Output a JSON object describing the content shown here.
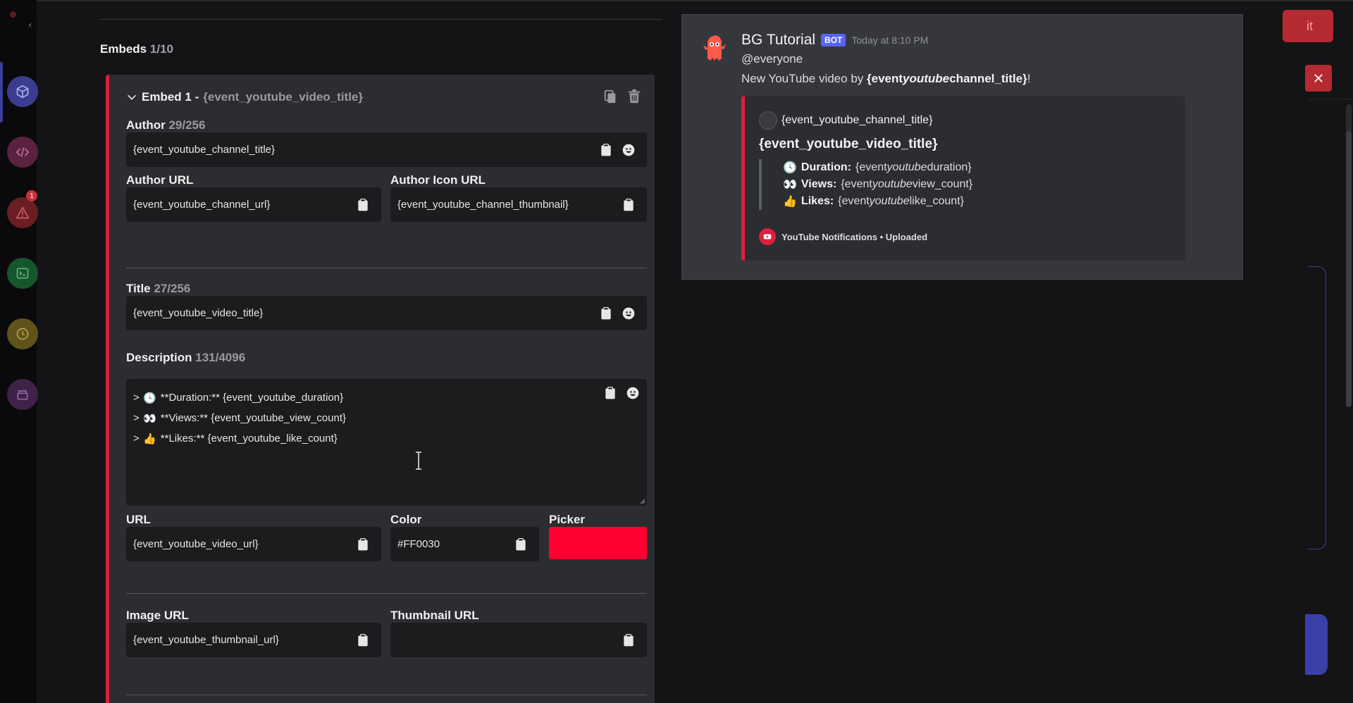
{
  "editor": {
    "embeds_label": "Embeds",
    "embeds_count": "1/10",
    "embed": {
      "title_prefix": "Embed 1 - ",
      "title_value": "{event_youtube_video_title}",
      "author": {
        "label": "Author",
        "count": "29/256",
        "value": "{event_youtube_channel_title}"
      },
      "author_url": {
        "label": "Author URL",
        "value": "{event_youtube_channel_url}"
      },
      "author_icon_url": {
        "label": "Author Icon URL",
        "value": "{event_youtube_channel_thumbnail}"
      },
      "title": {
        "label": "Title",
        "count": "27/256",
        "value": "{event_youtube_video_title}"
      },
      "description": {
        "label": "Description",
        "count": "131/4096",
        "lines": [
          {
            "prefix": ">",
            "emoji": "🕓",
            "text": "**Duration:** {event_youtube_duration}"
          },
          {
            "prefix": ">",
            "emoji": "👀",
            "text": "**Views:** {event_youtube_view_count}"
          },
          {
            "prefix": ">",
            "emoji": "👍",
            "text": "**Likes:** {event_youtube_like_count}"
          }
        ]
      },
      "url": {
        "label": "URL",
        "value": "{event_youtube_video_url}"
      },
      "color": {
        "label": "Color",
        "value": "#FF0030"
      },
      "picker": {
        "label": "Picker",
        "color": "#FF0030"
      },
      "image_url": {
        "label": "Image URL",
        "value": "{event_youtube_thumbnail_url}"
      },
      "thumbnail_url": {
        "label": "Thumbnail URL",
        "value": ""
      }
    }
  },
  "preview": {
    "bot_name": "BG Tutorial",
    "bot_tag": "BOT",
    "timestamp": "Today at 8:10 PM",
    "mention": "@everyone",
    "content_prefix": "New YouTube video by ",
    "content_bold_a": "{event",
    "content_italic": "youtube",
    "content_bold_b": "channel_title}",
    "content_suffix": "!",
    "embed": {
      "author": "{event_youtube_channel_title}",
      "title": "{event_youtube_video_title}",
      "rows": [
        {
          "emoji": "🕓",
          "label": "Duration:",
          "a": " {event",
          "i": "youtube",
          "b": "duration}"
        },
        {
          "emoji": "👀",
          "label": "Views:",
          "a": " {event",
          "i": "youtube",
          "b": "view_count}"
        },
        {
          "emoji": "👍",
          "label": "Likes:",
          "a": " {event",
          "i": "youtube",
          "b": "like_count}"
        }
      ],
      "footer": "YouTube Notifications • Uploaded"
    }
  },
  "background": {
    "top_button_label": "it",
    "sidebar_badge": "1"
  },
  "colors": {
    "accent_red": "#e01e3c",
    "picker_red": "#ff0030",
    "bot_tag": "#5865f2"
  }
}
